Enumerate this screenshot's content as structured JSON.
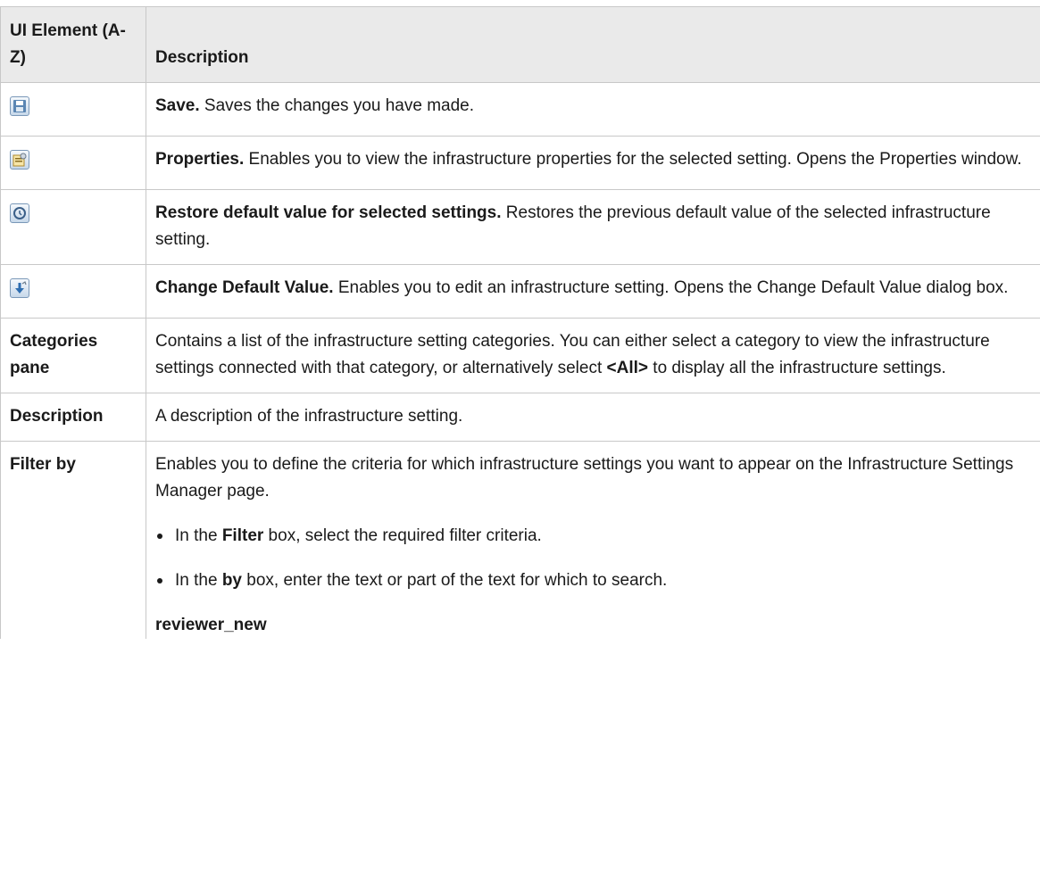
{
  "table": {
    "header": {
      "col1": "UI Element (A-Z)",
      "col2": "Description"
    },
    "icon_rows": [
      {
        "icon": "save-icon",
        "title": "Save.",
        "text": " Saves the changes you have made."
      },
      {
        "icon": "properties-icon",
        "title": "Properties.",
        "text": " Enables you to view the infrastructure properties for the selected setting. Opens the Properties window."
      },
      {
        "icon": "restore-icon",
        "title": "Restore default value for selected settings.",
        "text": " Restores the previous default value of the selected infrastructure setting."
      },
      {
        "icon": "change-default-icon",
        "title": "Change Default Value.",
        "text": " Enables you to edit an infrastructure setting. Opens the Change Default Value dialog box."
      }
    ],
    "categories": {
      "element": "Categories pane",
      "text_before": "Contains a list of the infrastructure setting categories. You can either select a category to view the infrastructure settings connected with that category, or alternatively select ",
      "bold": "<All>",
      "text_after": " to display all the infrastructure settings."
    },
    "description_row": {
      "element": "Description",
      "text": "A description of the infrastructure setting."
    },
    "filter": {
      "element": "Filter by",
      "text": "Enables you to define the criteria for which infrastructure settings you want to appear on the Infrastructure Settings Manager page.",
      "bullets": [
        {
          "pre": "In the ",
          "bold": "Filter",
          "post": " box, select the required filter criteria."
        },
        {
          "pre": "In the ",
          "bold": "by",
          "post": " box, enter the text or part of the text for which to search."
        }
      ],
      "note": "reviewer_new"
    }
  }
}
